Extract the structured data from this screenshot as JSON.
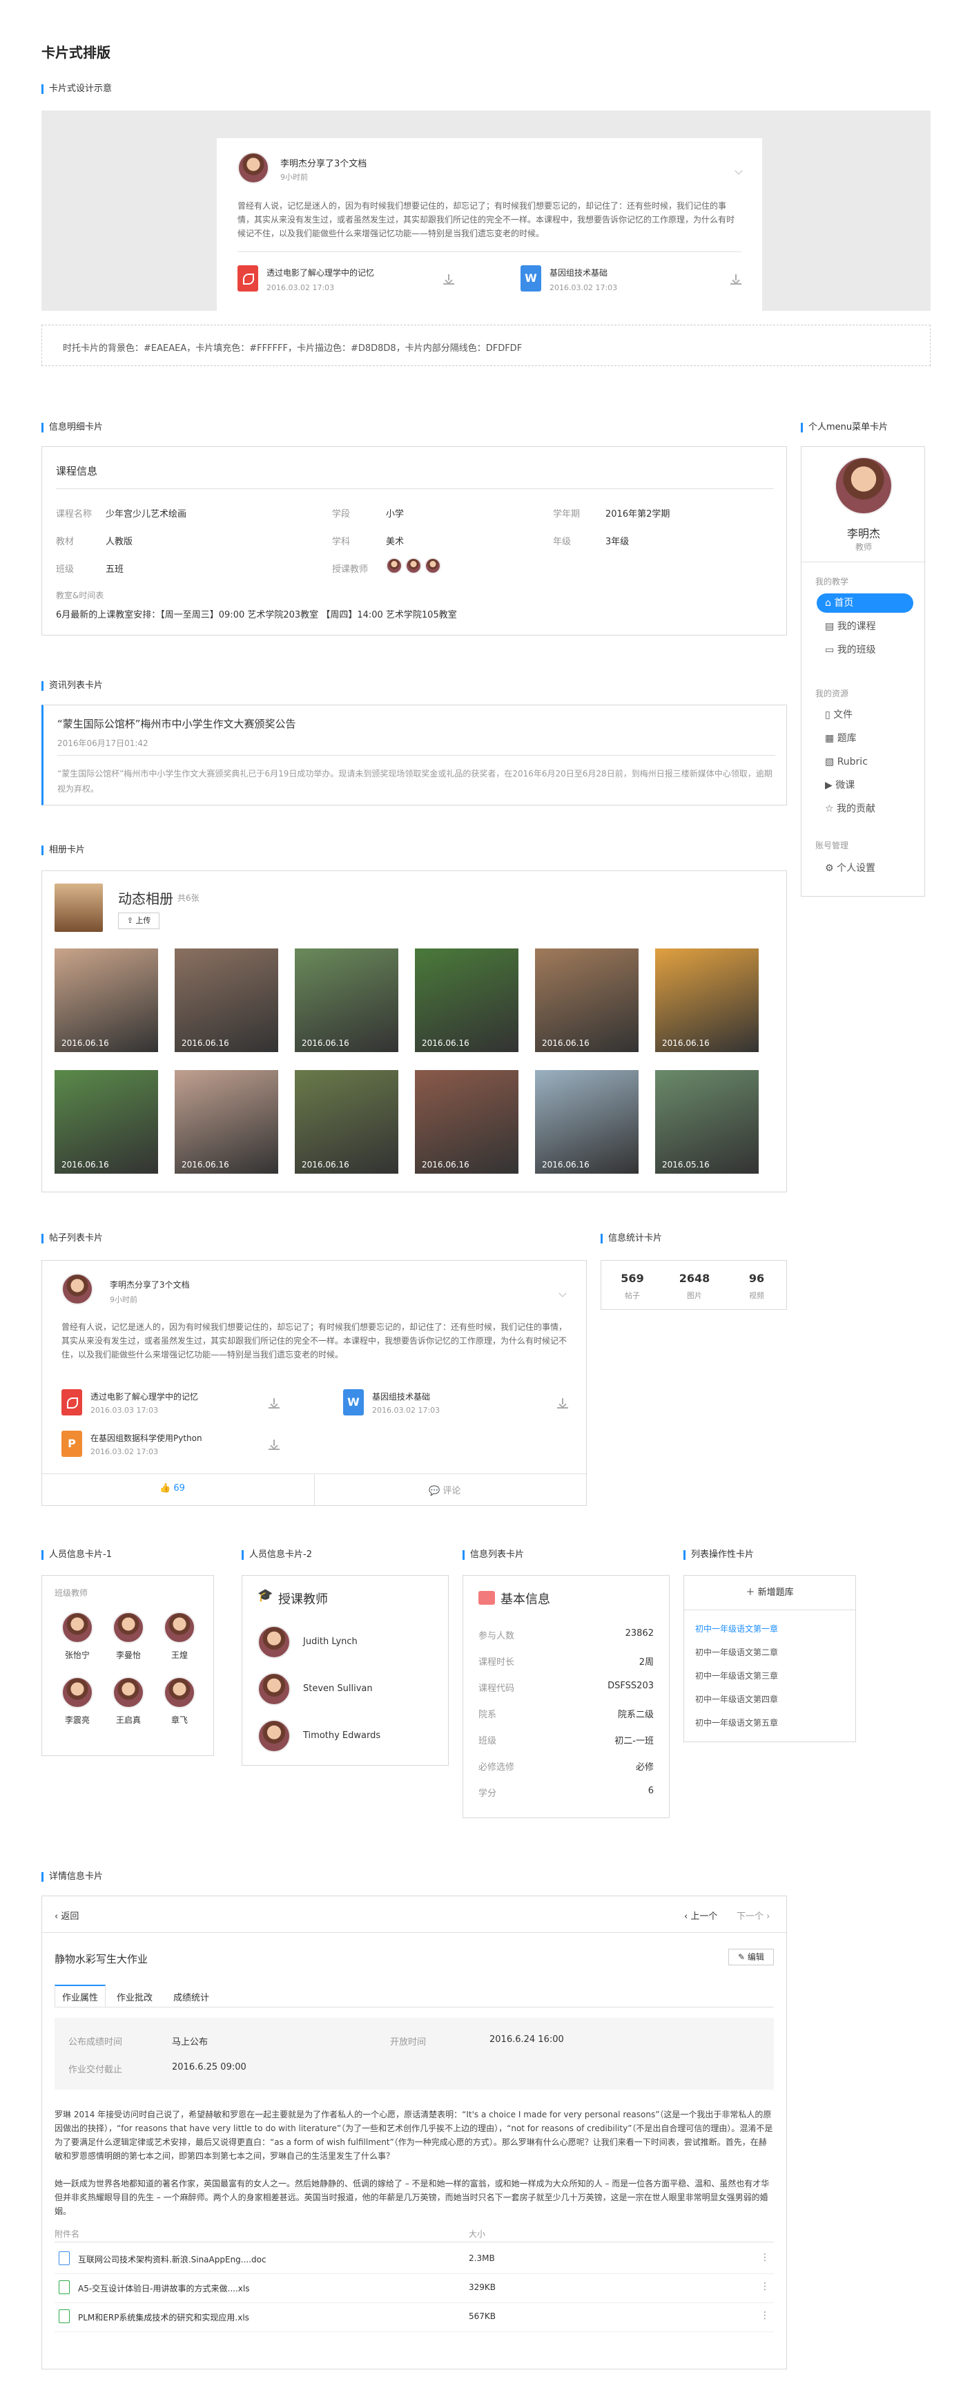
{
  "page_title": "卡片式排版",
  "section1": {
    "label": "卡片式设计示意",
    "post_user": "李明杰分享了3个文档",
    "post_time": "9小时前",
    "post_body": "曾经有人说，记忆是迷人的，因为有时候我们想要记住的，却忘记了；有时候我们想要忘记的，却记住了：还有些时候，我们记住的事情，其实从来没有发生过，或者虽然发生过，其实却跟我们所记住的完全不一样。本课程中，我想要告诉你记忆的工作原理，为什么有时候记不住，以及我们能做些什么来增强记忆功能——特别是当我们遗忘变老的时候。",
    "file1_name": "透过电影了解心理学中的记忆",
    "file1_meta": "2016.03.02     17:03",
    "file2_name": "基因组技术基础",
    "file2_meta": "2016.03.02     17:03",
    "note": "时托卡片的背景色：#EAEAEA，卡片填充色：#FFFFFF，卡片描边色：#D8D8D8，卡片内部分隔线色：DFDFDF"
  },
  "detail_card": {
    "label": "信息明细卡片",
    "title": "课程信息",
    "r1": [
      "课程名称",
      "少年宫少儿艺术绘画",
      "学段",
      "小学",
      "学年期",
      "2016年第2学期"
    ],
    "r2": [
      "教材",
      "人教版",
      "学科",
      "美术",
      "年级",
      "3年级"
    ],
    "r3": [
      "班级",
      "五班",
      "授课教师"
    ],
    "time_label": "教室&时间表",
    "time_value": "6月最新的上课教室安排：【周一至周三】09:00 艺术学院203教室        【周四】14:00 艺术学院105教室"
  },
  "news_card": {
    "label": "资讯列表卡片",
    "title": "“蒙生国际公馆杯”梅州市中小学生作文大赛颁奖公告",
    "date": "2016年06月17日01:42",
    "body": "“蒙生国际公馆杯”梅州市中小学生作文大赛颁奖典礼已于6月19日成功举办。现请未到颁奖现场领取奖金或礼品的获奖者，在2016年6月20日至6月28日前，到梅州日报三楼新媒体中心领取，逾期视为弃权。"
  },
  "album": {
    "label": "相册卡片",
    "title": "动态相册",
    "count": "共6张",
    "upload": "上传",
    "photos": [
      "2016.06.16",
      "2016.06.16",
      "2016.06.16",
      "2016.06.16",
      "2016.06.16",
      "2016.06.16",
      "2016.06.16",
      "2016.06.16",
      "2016.06.16",
      "2016.06.16",
      "2016.06.16",
      "2016.05.16"
    ]
  },
  "profile": {
    "label": "个人menu菜单卡片",
    "name": "李明杰",
    "role": "教师",
    "g1": "我的教学",
    "home": "首页",
    "my_course": "我的课程",
    "my_class": "我的班级",
    "g2": "我的资源",
    "files": "文件",
    "question_bank": "题库",
    "rubric": "Rubric",
    "micro": "微课",
    "contrib": "我的贡献",
    "g3": "账号管理",
    "settings": "个人设置"
  },
  "post_list": {
    "label": "帖子列表卡片",
    "user": "李明杰分享了3个文档",
    "time": "9小时前",
    "body": "曾经有人说，记忆是迷人的，因为有时候我们想要记住的，却忘记了；有时候我们想要忘记的，却记住了：还有些时候，我们记住的事情，其实从来没有发生过，或者虽然发生过，其实却跟我们所记住的完全不一样。本课程中，我想要告诉你记忆的工作原理，为什么有时候记不住，以及我们能做些什么来增强记忆功能——特别是当我们遗忘变老的时候。",
    "f1": "透过电影了解心理学中的记忆",
    "f1m": "2016.03.03     17:03",
    "f2": "基因组技术基础",
    "f2m": "2016.03.02     17:03",
    "f3": "在基因组数据科学使用Python",
    "f3m": "2016.03.02     17:03",
    "likes": "69",
    "comment": "评论"
  },
  "stats": {
    "label": "信息统计卡片",
    "a": "569",
    "al": "帖子",
    "b": "2648",
    "bl": "图片",
    "c": "96",
    "cl": "视频"
  },
  "people1": {
    "label": "人员信息卡片-1",
    "head": "班级教师",
    "names": [
      "张怡宁",
      "李曼怡",
      "王煌",
      "李震亮",
      "王启真",
      "章飞"
    ]
  },
  "people2": {
    "label": "人员信息卡片-2",
    "title": "授课教师",
    "names": [
      "Judith Lynch",
      "Steven Sullivan",
      "Timothy Edwards"
    ]
  },
  "info_list": {
    "label": "信息列表卡片",
    "title": "基本信息",
    "rows": [
      [
        "参与人数",
        "23862"
      ],
      [
        "课程时长",
        "2周"
      ],
      [
        "课程代码",
        "DSFSS203"
      ],
      [
        "院系",
        "院系二级"
      ],
      [
        "班级",
        "初二-一班"
      ],
      [
        "必修选修",
        "必修"
      ],
      [
        "学分",
        "6"
      ]
    ]
  },
  "op_list": {
    "label": "列表操作性卡片",
    "add": "新增题库",
    "items": [
      "初中一年级语文第一章",
      "初中一年级语文第二章",
      "初中一年级语文第三章",
      "初中一年级语文第四章",
      "初中一年级语文第五章"
    ]
  },
  "detail_info": {
    "label": "详情信息卡片",
    "back": "返回",
    "prev": "上一个",
    "next": "下一个",
    "title": "静物水彩写生大作业",
    "edit": "编辑",
    "tabs": [
      "作业属性",
      "作业批改",
      "成绩统计"
    ],
    "k1": "公布成绩时间",
    "v1": "马上公布",
    "k2": "开放时间",
    "v2": "2016.6.24 16:00",
    "k3": "作业交付截止",
    "v3": "2016.6.25 09:00",
    "p1": "罗琳 2014 年接受访问时自己说了，希望赫敏和罗恩在一起主要就是为了作者私人的一个心愿，原话清楚表明：“It's a choice I made for very personal reasons”（这是一个我出于非常私人的原因做出的抉择），“for reasons that have very little to do with literature”（为了一些和艺术创作几乎挨不上边的理由），“not for reasons of credibility”（不是出自合理可信的理由）。混淆不是为了要满足什么逻辑定律或艺术安排，最后又说得更直白：“as a form of wish fulfillment”（作为一种完成心愿的方式）。那么罗琳有什么心愿呢？让我们来看一下时间表，尝试推断。首先，在赫敏和罗恩感情明朗的第七本之间，即第四本到第七本之间，罗琳自己的生活里发生了什么事？",
    "p2": "她一跃成为世界各地都知道的著名作家，英国最富有的女人之一。然后她静静的、低调的嫁给了 – 不是和她一样的富翁，或和她一样成为大众所知的人 – 而是一位各方面平稳、温和、虽然也有才华但并非炙热耀眼导目的先生 – 一个麻醉师。两个人的身家相差甚远。英国当时报道，他的年薪是几万英镑，而她当时只名下一套房子就至少几十万英镑，这是一宗在世人眼里非常明显女强男弱的婚姻。",
    "att_h": "附件名",
    "size_h": "大小",
    "att": [
      [
        "互联网公司技术架构资料.新浪.SinaAppEng....doc",
        "2.3MB"
      ],
      [
        "A5-交互设计体验日-用讲故事的方式来做....xls",
        "329KB"
      ],
      [
        "PLM和ERP系统集成技术的研究和实现应用.xls",
        "567KB"
      ]
    ]
  }
}
